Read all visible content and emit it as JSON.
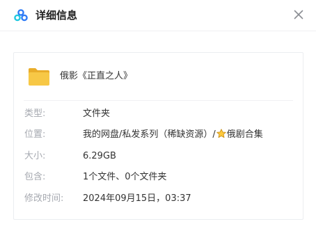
{
  "header": {
    "title": "详细信息",
    "logo_icon": "baidu-netdisk-logo-icon",
    "close_icon": "close-icon"
  },
  "file": {
    "name": "俄影《正直之人》",
    "icon": "folder-icon"
  },
  "details": {
    "type": {
      "label": "类型:",
      "value": "文件夹"
    },
    "location": {
      "label": "位置:",
      "value_before_icon": "我的网盘/私发系列（稀缺资源）/",
      "icon": "star-icon",
      "value_after_icon": "俄剧合集"
    },
    "size": {
      "label": "大小:",
      "value": "6.29GB"
    },
    "contains": {
      "label": "包含:",
      "value": "1个文件、0个文件夹"
    },
    "modified": {
      "label": "修改时间:",
      "value": "2024年09月15日，03:37"
    }
  },
  "colors": {
    "label": "#a6a9b0",
    "value": "#333333",
    "folder": "#f5c343",
    "logo_blue": "#2f7cf6",
    "logo_cyan": "#1fc8e0"
  }
}
